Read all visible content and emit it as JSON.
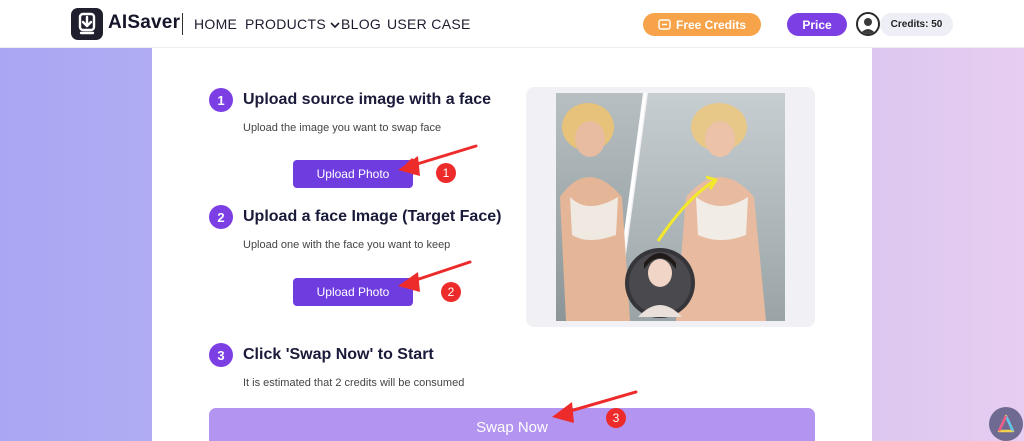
{
  "header": {
    "brand": "AISaver",
    "nav": {
      "home": "HOME",
      "products": "PRODUCTS",
      "blog": "BLOG",
      "user_case": "USER CASE"
    },
    "free_credits_label": "Free Credits",
    "price_label": "Price",
    "credits_label": "Credits: 50"
  },
  "steps": [
    {
      "number": "1",
      "title": "Upload source image with a face",
      "description": "Upload the image you want to swap face",
      "button_label": "Upload Photo",
      "badge": "1"
    },
    {
      "number": "2",
      "title": "Upload a face Image (Target Face)",
      "description": "Upload one with the face you want to keep",
      "button_label": "Upload Photo",
      "badge": "2"
    },
    {
      "number": "3",
      "title": "Click 'Swap Now' to Start",
      "description": "It is estimated that 2 credits will be consumed",
      "badge": "3"
    }
  ],
  "swap_button_label": "Swap Now",
  "colors": {
    "accent": "#7b3fe4",
    "orange": "#f7a34a",
    "swap_disabled": "#b394f0",
    "badge_red": "#ee2b2b"
  }
}
